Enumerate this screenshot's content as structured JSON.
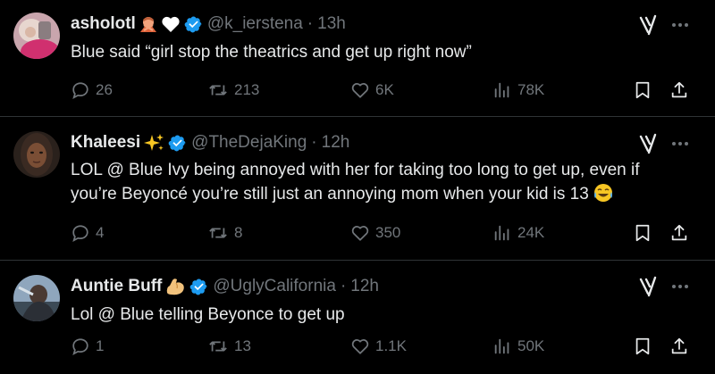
{
  "tweets": [
    {
      "name": "asholotl",
      "name_emojis": [
        "person-gesturing-no-emoji",
        "white-heart-emoji"
      ],
      "handle": "@k_ierstena",
      "time": "13h",
      "text": "Blue said “girl stop the theatrics and get up right now”",
      "replies": "26",
      "retweets": "213",
      "likes": "6K",
      "views": "78K"
    },
    {
      "name": "Khaleesi",
      "name_emojis": [
        "sparkles-emoji"
      ],
      "handle": "@TheDejaKing",
      "time": "12h",
      "text": "LOL @ Blue Ivy being annoyed with her for taking too long to get up, even if you’re Beyoncé you’re still just an annoying mom when your kid is 13",
      "text_emoji": "face-with-tears-of-joy-emoji",
      "replies": "4",
      "retweets": "8",
      "likes": "350",
      "views": "24K"
    },
    {
      "name": "Auntie Buff",
      "name_emojis": [
        "flexed-biceps-emoji"
      ],
      "handle": "@UglyCalifornia",
      "time": "12h",
      "text": "Lol @ Blue telling Beyonce to get up",
      "replies": "1",
      "retweets": "13",
      "likes": "1.1K",
      "views": "50K"
    }
  ],
  "colors": {
    "background": "#000000",
    "text": "#e7e9ea",
    "secondary": "#71767b",
    "divider": "#2f3336",
    "verified": "#1d9bf0"
  },
  "icons": [
    "reply-icon",
    "retweet-icon",
    "like-icon",
    "views-icon",
    "bookmark-icon",
    "share-icon",
    "grok-icon",
    "more-icon",
    "verified-badge-icon"
  ]
}
